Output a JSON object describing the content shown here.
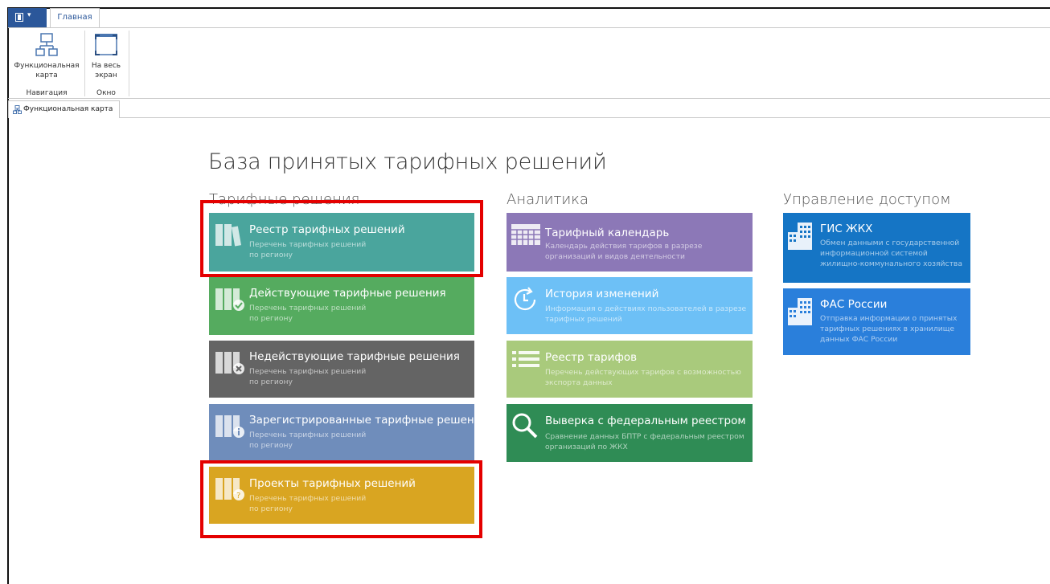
{
  "ribbon": {
    "tab_home": "Главная",
    "btn_map": [
      "Функциональная",
      "карта"
    ],
    "btn_fullscreen": [
      "На весь",
      "экран"
    ],
    "group_nav": "Навигация",
    "group_window": "Окно"
  },
  "doc_tab": "Функциональная карта",
  "page_title": "База принятых тарифных решений",
  "columns": {
    "tariff": "Тарифные решения",
    "analytics": "Аналитика",
    "access": "Управление доступом"
  },
  "tiles": {
    "registry": {
      "title": "Реестр тарифных решений",
      "desc": [
        "Перечень тарифных решений",
        "по региону"
      ],
      "color": "#4aa59d"
    },
    "active": {
      "title": "Действующие тарифные решения",
      "desc": [
        "Перечень тарифных решений",
        "по региону"
      ],
      "color": "#55ab5f"
    },
    "inactive": {
      "title": "Недействующие тарифные решения",
      "desc": [
        "Перечень тарифных решений",
        "по региону"
      ],
      "color": "#646464"
    },
    "registered": {
      "title": "Зарегистрированные тарифные решения",
      "desc": [
        "Перечень тарифных решений",
        "по региону"
      ],
      "color": "#6f8dbb"
    },
    "projects": {
      "title": "Проекты тарифных решений",
      "desc": [
        "Перечень тарифных решений",
        "по региону"
      ],
      "color": "#d9a521"
    },
    "calendar": {
      "title": "Тарифный календарь",
      "desc": [
        "Календарь действия тарифов в разрезе",
        "организаций и видов деятельности"
      ],
      "color": "#8c78b7"
    },
    "history": {
      "title": "История изменений",
      "desc": [
        "Информация о действиях пользователей в разрезе",
        "тарифных решений"
      ],
      "color": "#6dc0f6"
    },
    "tariff_registry": {
      "title": "Реестр тарифов",
      "desc": [
        "Перечень действующих тарифов с возможностью",
        "экспорта данных"
      ],
      "color": "#a9ca7c"
    },
    "reconcile": {
      "title": "Выверка с федеральным реестром",
      "desc": [
        "Сравнение данных БПТР с федеральным реестром",
        "организаций по ЖКХ"
      ],
      "color": "#2f8c55"
    },
    "gis": {
      "title": "ГИС ЖКХ",
      "desc": [
        "Обмен данными с государственной",
        "информационной системой",
        "жилищно-коммунального хозяйства"
      ],
      "color": "#1575c5"
    },
    "fas": {
      "title": "ФАС России",
      "desc": [
        "Отправка информации о принятых",
        "тарифных решениях в хранилище",
        "данных ФАС России"
      ],
      "color": "#2a7fdb"
    }
  },
  "highlight_color": "#e40000"
}
